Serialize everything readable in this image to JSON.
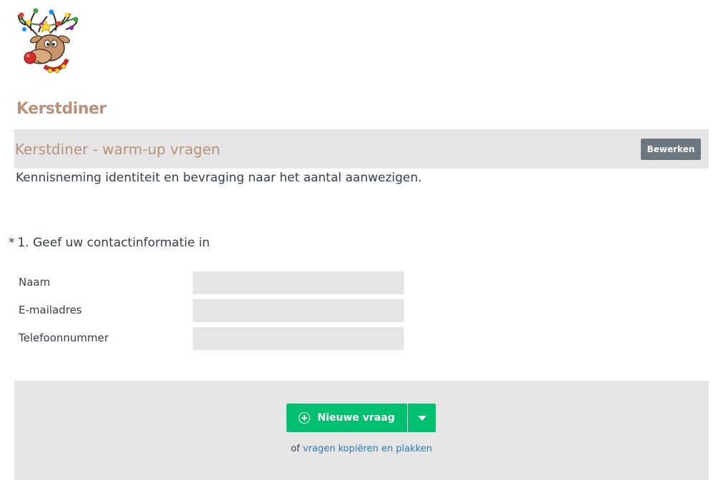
{
  "survey": {
    "logo_icon": "reindeer-christmas-lights-icon",
    "title": "Kerstdiner"
  },
  "page": {
    "title": "Kerstdiner - warm-up vragen",
    "edit_label": "Bewerken",
    "description": "Kennisneming identiteit en bevraging naar het aantal aanwezigen."
  },
  "question": {
    "required_marker": "*",
    "text": "1. Geef uw contactinformatie in",
    "fields": [
      {
        "label": "Naam",
        "value": ""
      },
      {
        "label": "E-mailadres",
        "value": ""
      },
      {
        "label": "Telefoonnummer",
        "value": ""
      }
    ]
  },
  "footer": {
    "new_question_label": "Nieuwe vraag",
    "new_question_icon": "plus-circle-icon",
    "dropdown_icon": "caret-down-icon",
    "or_text": "of",
    "copy_link_text": "vragen kopiëren en plakken"
  },
  "colors": {
    "title_accent": "#b7927a",
    "primary_green": "#00bf6f",
    "edit_button": "#6b7880",
    "link": "#2a7ab0",
    "panel_bg": "#e5e5e5"
  }
}
